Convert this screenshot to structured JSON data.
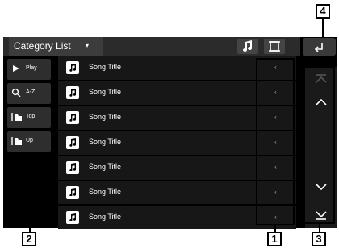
{
  "header": {
    "category_label": "Category List",
    "dropdown_caret": "▾"
  },
  "sidebar": {
    "items": [
      {
        "label": "Play",
        "icon": "play-icon"
      },
      {
        "label": "A-Z",
        "icon": "search-icon"
      },
      {
        "label": "Top",
        "icon": "folder-top-icon"
      },
      {
        "label": "Up",
        "icon": "folder-up-icon"
      }
    ]
  },
  "list": {
    "items": [
      {
        "title": "Song Title"
      },
      {
        "title": "Song Title"
      },
      {
        "title": "Song Title"
      },
      {
        "title": "Song Title"
      },
      {
        "title": "Song Title"
      },
      {
        "title": "Song Title"
      },
      {
        "title": "Song Title"
      }
    ],
    "chevron": "‹"
  },
  "callouts": {
    "one": "1",
    "two": "2",
    "three": "3",
    "four": "4"
  },
  "colors": {
    "screen": "#000000",
    "row": "#171717",
    "button": "#2e2e2e"
  }
}
